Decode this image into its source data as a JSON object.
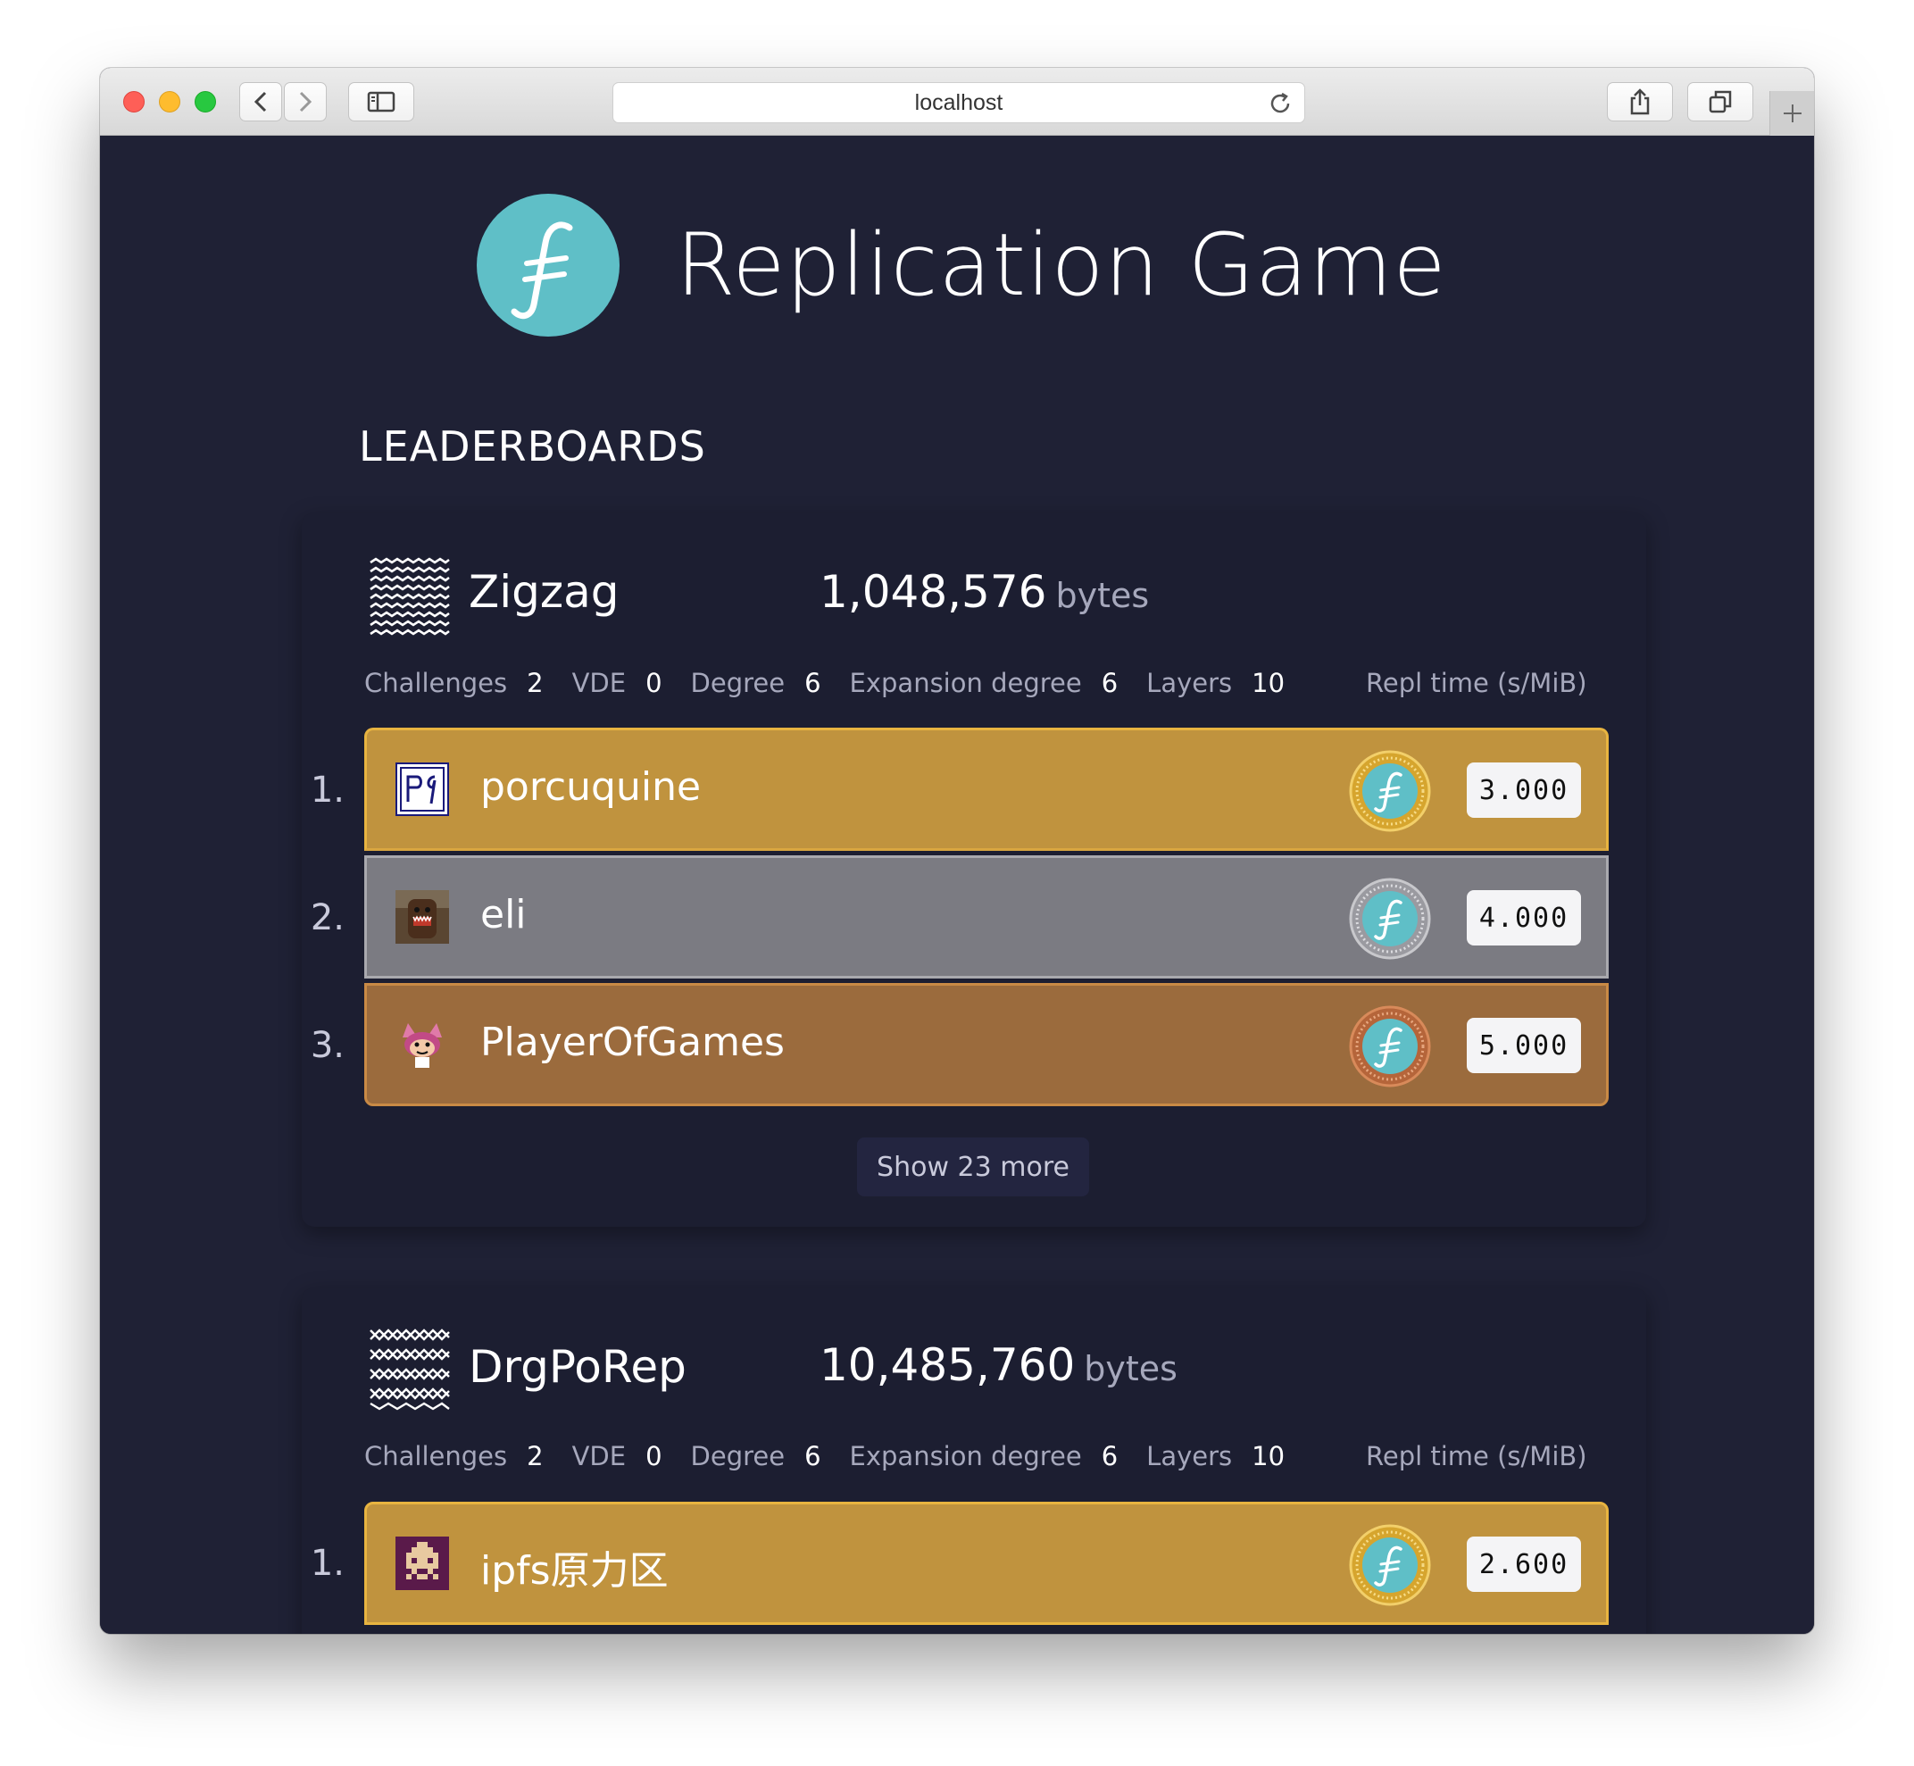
{
  "browser": {
    "url": "localhost"
  },
  "header": {
    "title": "Replication Game",
    "logo_glyph": "ƒ"
  },
  "section_title": "LEADERBOARDS",
  "colors": {
    "background": "#1f2135",
    "card": "#1c1e31",
    "brand_teal": "#5fbfc7",
    "gold": "#c0933e",
    "silver": "#7b7b82",
    "bronze": "#9b6b3d"
  },
  "leaderboards": [
    {
      "name": "Zigzag",
      "icon": "zigzag-pattern-icon",
      "size_value": "1,048,576",
      "size_unit": "bytes",
      "params": [
        {
          "label": "Challenges",
          "value": "2"
        },
        {
          "label": "VDE",
          "value": "0"
        },
        {
          "label": "Degree",
          "value": "6"
        },
        {
          "label": "Expansion degree",
          "value": "6"
        },
        {
          "label": "Layers",
          "value": "10"
        }
      ],
      "score_header": "Repl time (s/MiB)",
      "entries": [
        {
          "rank": "1.",
          "name": "porcuquine",
          "medal": "gold",
          "score": "3.000",
          "avatar": "pq-avatar"
        },
        {
          "rank": "2.",
          "name": "eli",
          "medal": "silver",
          "score": "4.000",
          "avatar": "domo-avatar"
        },
        {
          "rank": "3.",
          "name": "PlayerOfGames",
          "medal": "bronze",
          "score": "5.000",
          "avatar": "cat-avatar"
        }
      ],
      "show_more": "Show 23 more"
    },
    {
      "name": "DrgPoRep",
      "icon": "drg-pattern-icon",
      "size_value": "10,485,760",
      "size_unit": "bytes",
      "params": [
        {
          "label": "Challenges",
          "value": "2"
        },
        {
          "label": "VDE",
          "value": "0"
        },
        {
          "label": "Degree",
          "value": "6"
        },
        {
          "label": "Expansion degree",
          "value": "6"
        },
        {
          "label": "Layers",
          "value": "10"
        }
      ],
      "score_header": "Repl time (s/MiB)",
      "entries": [
        {
          "rank": "1.",
          "name": "ipfs原力区",
          "medal": "gold",
          "score": "2.600",
          "avatar": "pixel-invader-avatar"
        }
      ]
    }
  ]
}
